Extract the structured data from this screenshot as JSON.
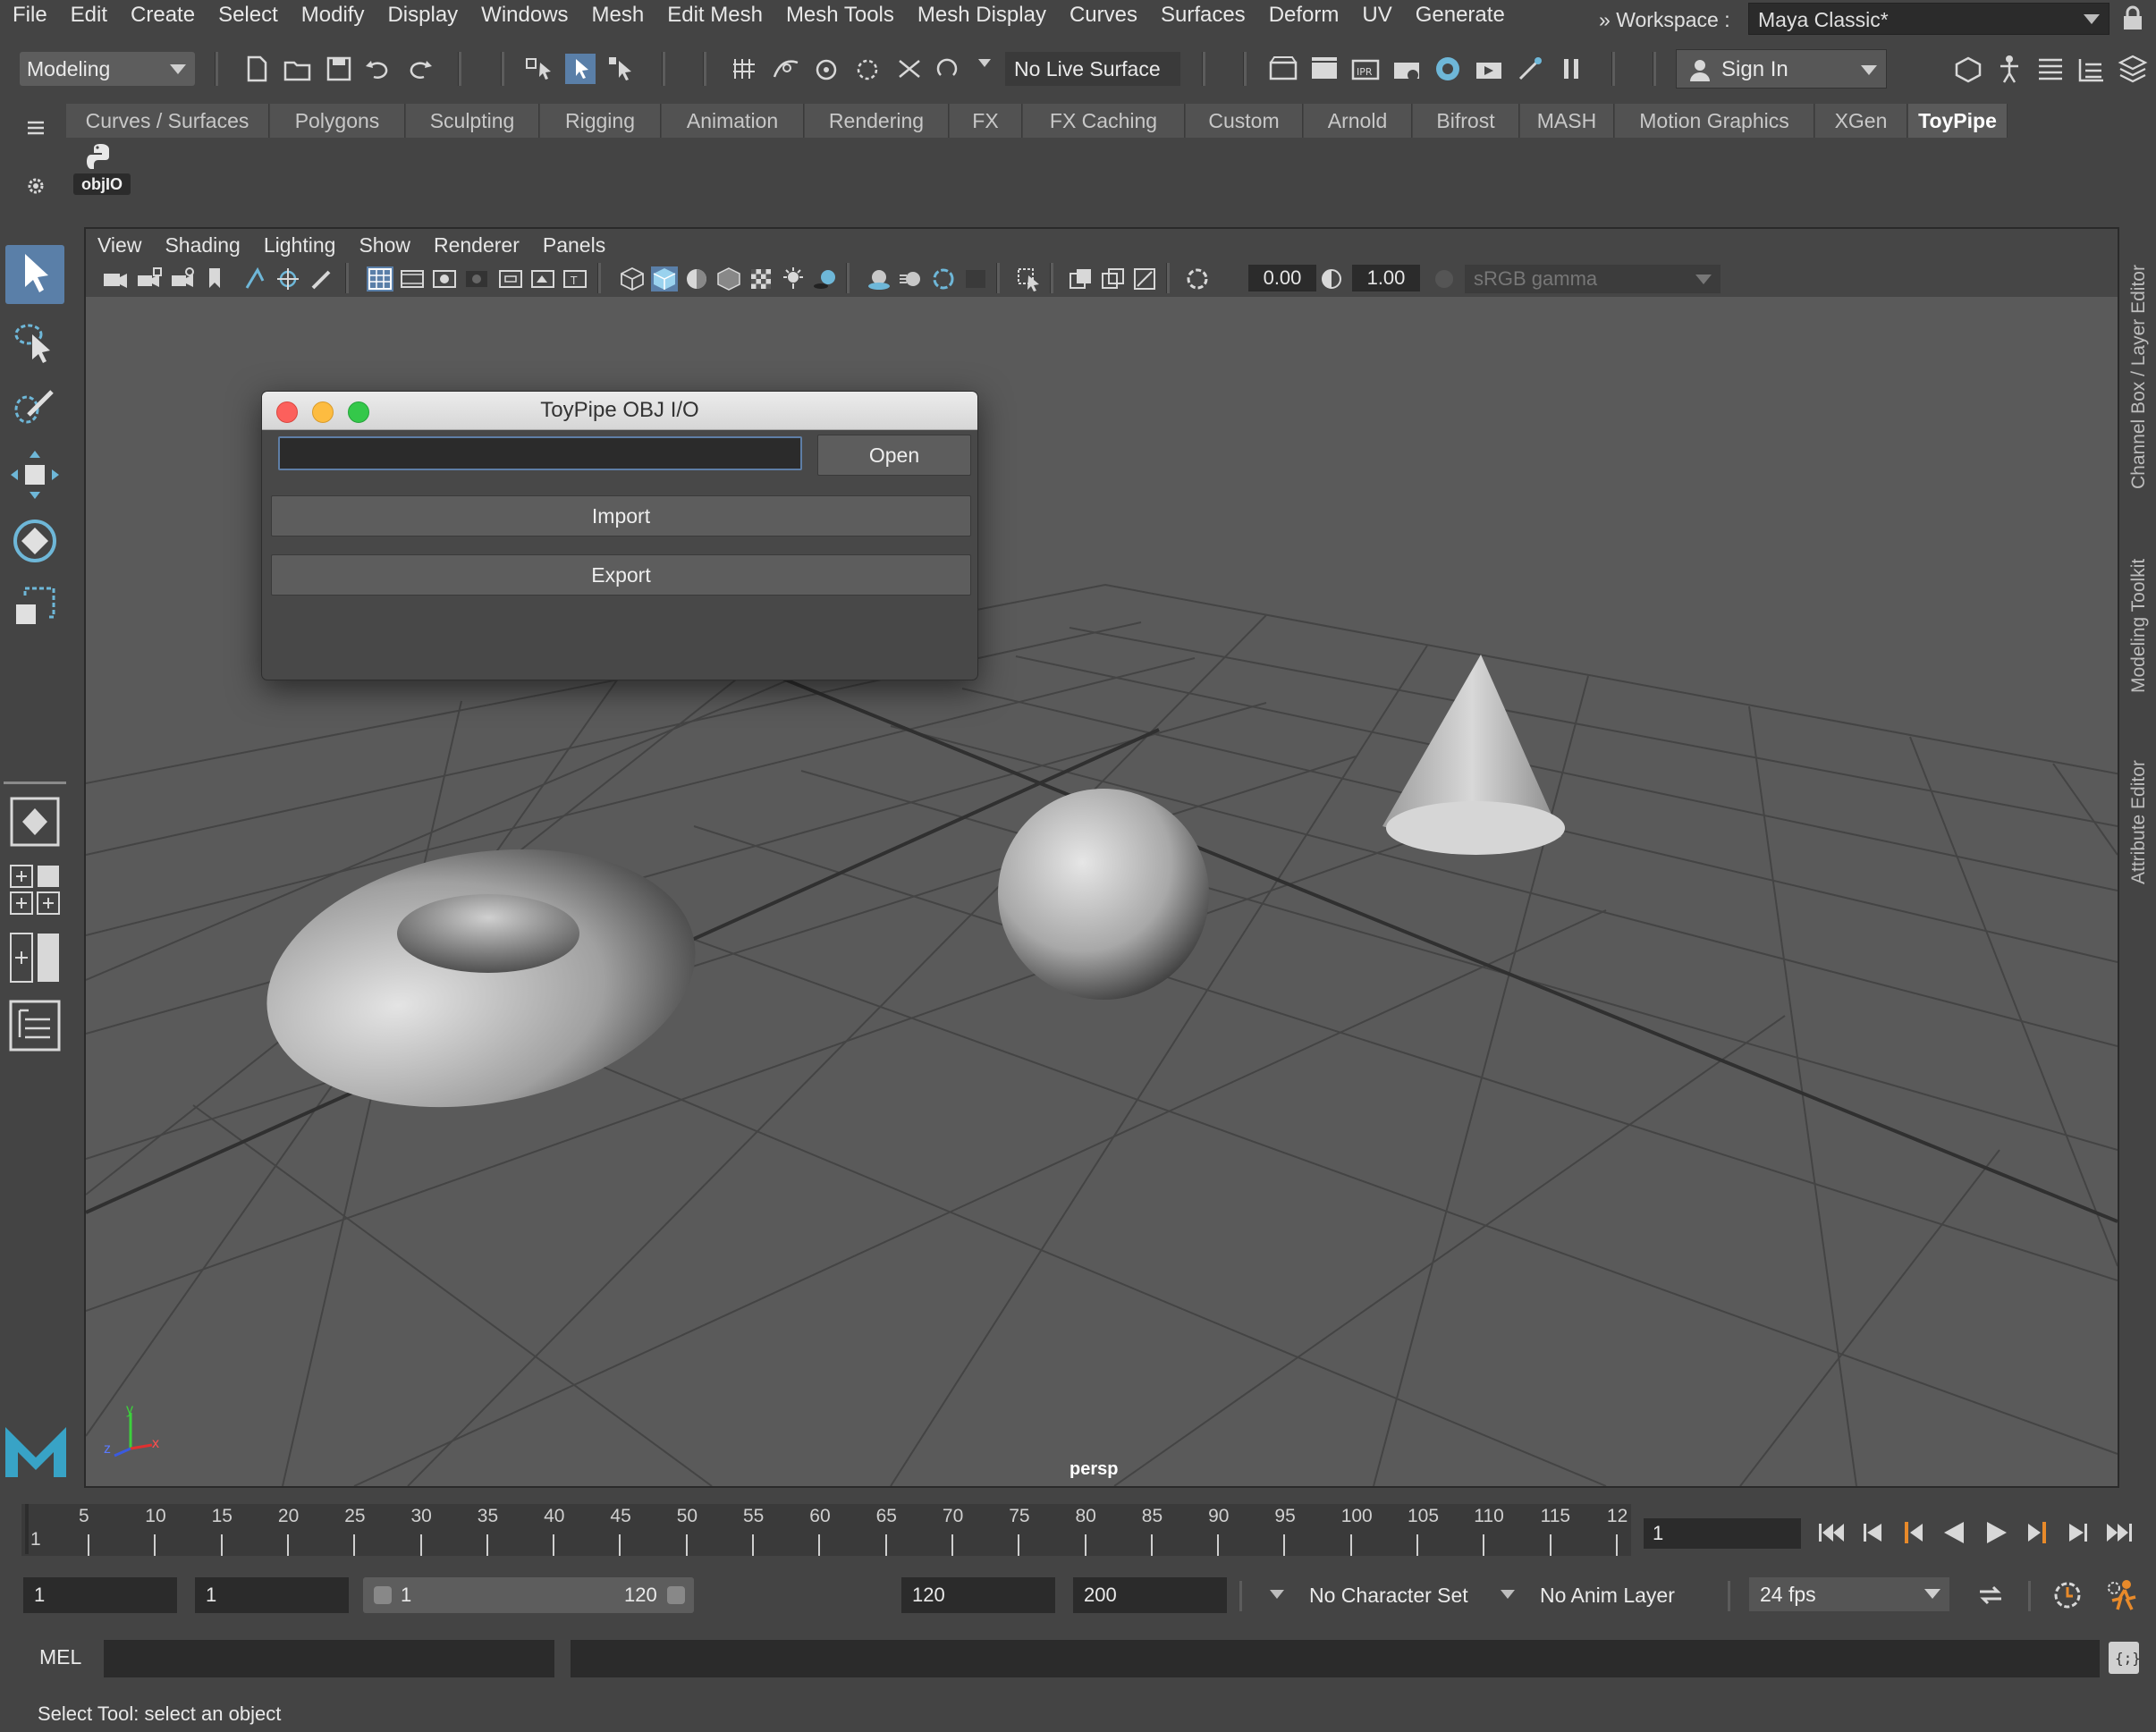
{
  "menu": {
    "items": [
      "File",
      "Edit",
      "Create",
      "Select",
      "Modify",
      "Display",
      "Windows",
      "Mesh",
      "Edit Mesh",
      "Mesh Tools",
      "Mesh Display",
      "Curves",
      "Surfaces",
      "Deform",
      "UV",
      "Generate"
    ],
    "workspace_label": "Workspace :",
    "workspace_value": "Maya Classic*"
  },
  "statusline": {
    "mode": "Modeling",
    "live_surface": "No Live Surface",
    "sign_in": "Sign In"
  },
  "shelf": {
    "tabs": [
      "Curves / Surfaces",
      "Polygons",
      "Sculpting",
      "Rigging",
      "Animation",
      "Rendering",
      "FX",
      "FX Caching",
      "Custom",
      "Arnold",
      "Bifrost",
      "MASH",
      "Motion Graphics",
      "XGen",
      "ToyPipe"
    ],
    "active_tab": "ToyPipe",
    "button_label": "objIO"
  },
  "viewport": {
    "menu": [
      "View",
      "Shading",
      "Lighting",
      "Show",
      "Renderer",
      "Panels"
    ],
    "exposure": "0.00",
    "gamma_value": "1.00",
    "color_space": "sRGB gamma",
    "camera": "persp",
    "axis_labels": {
      "y": "y",
      "z": "z",
      "x": "x"
    }
  },
  "right_tabs": [
    "Channel Box / Layer Editor",
    "Modeling Toolkit",
    "Attribute Editor"
  ],
  "dialog": {
    "title": "ToyPipe OBJ I/O",
    "path_value": "",
    "open_label": "Open",
    "import_label": "Import",
    "export_label": "Export"
  },
  "timeline": {
    "first_label": "1",
    "ticks": [
      "5",
      "10",
      "15",
      "20",
      "25",
      "30",
      "35",
      "40",
      "45",
      "50",
      "55",
      "60",
      "65",
      "70",
      "75",
      "80",
      "85",
      "90",
      "95",
      "100",
      "105",
      "110",
      "115",
      "12"
    ],
    "current_frame": "1"
  },
  "range": {
    "start": "1",
    "playback_start": "1",
    "slider_start": "1",
    "slider_end": "120",
    "playback_end": "120",
    "end": "200",
    "character_set": "No Character Set",
    "anim_layer": "No Anim Layer",
    "fps": "24 fps"
  },
  "command": {
    "language": "MEL",
    "help": "Select Tool: select an object"
  },
  "colors": {
    "accent": "#5a7fa8",
    "viewport_bg": "#5a5a5a",
    "close": "#fc605c",
    "minimize": "#fdbc40",
    "zoom": "#34c84a"
  }
}
